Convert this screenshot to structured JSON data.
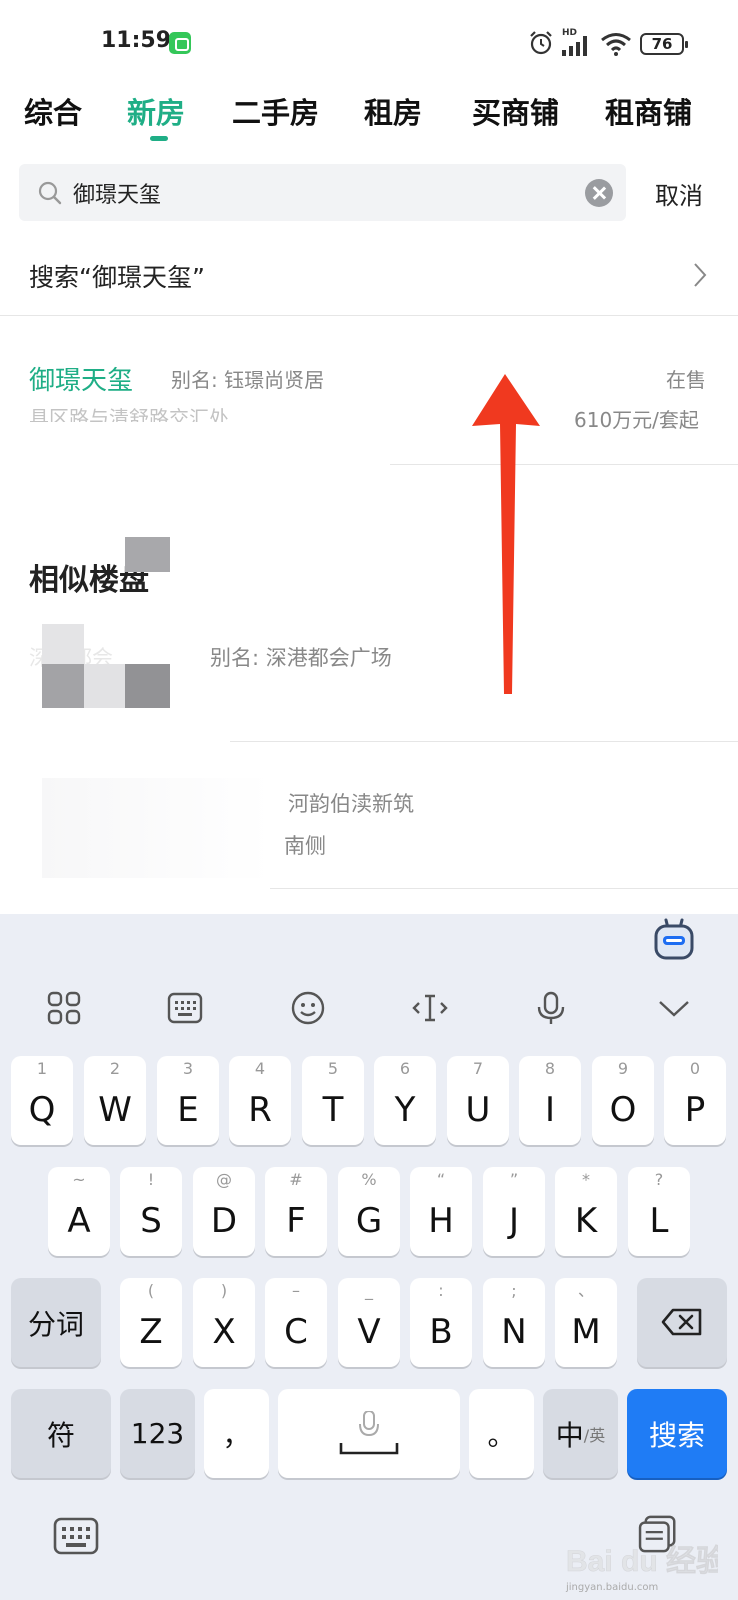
{
  "status_bar": {
    "time": "11:59",
    "hd_label": "HD",
    "battery": "76"
  },
  "tabs": [
    {
      "label": "综合",
      "active": false
    },
    {
      "label": "新房",
      "active": true
    },
    {
      "label": "二手房",
      "active": false
    },
    {
      "label": "租房",
      "active": false
    },
    {
      "label": "买商铺",
      "active": false
    },
    {
      "label": "租商铺",
      "active": false
    }
  ],
  "search": {
    "value": "御璟天玺",
    "cancel_label": "取消",
    "suggestion": "搜索“御璟天玺”"
  },
  "result": {
    "name": "御璟天玺",
    "alias": "别名: 钰璟尚贤居",
    "status": "在售",
    "address": "具区路与清舒路交汇处",
    "price": "610万元/套起"
  },
  "similar": {
    "title": "相似楼盘",
    "items": [
      {
        "name": "深港都会",
        "alias": "别名: 深港都会广场"
      },
      {
        "alias": "河韵伯渎新筑",
        "address": "南侧"
      }
    ]
  },
  "keyboard": {
    "row1": [
      {
        "hint": "1",
        "key": "Q"
      },
      {
        "hint": "2",
        "key": "W"
      },
      {
        "hint": "3",
        "key": "E"
      },
      {
        "hint": "4",
        "key": "R"
      },
      {
        "hint": "5",
        "key": "T"
      },
      {
        "hint": "6",
        "key": "Y"
      },
      {
        "hint": "7",
        "key": "U"
      },
      {
        "hint": "8",
        "key": "I"
      },
      {
        "hint": "9",
        "key": "O"
      },
      {
        "hint": "0",
        "key": "P"
      }
    ],
    "row2": [
      {
        "hint": "~",
        "key": "A"
      },
      {
        "hint": "!",
        "key": "S"
      },
      {
        "hint": "@",
        "key": "D"
      },
      {
        "hint": "#",
        "key": "F"
      },
      {
        "hint": "%",
        "key": "G"
      },
      {
        "hint": "“",
        "key": "H"
      },
      {
        "hint": "”",
        "key": "J"
      },
      {
        "hint": "*",
        "key": "K"
      },
      {
        "hint": "?",
        "key": "L"
      }
    ],
    "row3": [
      {
        "hint": "(",
        "key": "Z"
      },
      {
        "hint": ")",
        "key": "X"
      },
      {
        "hint": "–",
        "key": "C"
      },
      {
        "hint": "_",
        "key": "V"
      },
      {
        "hint": ":",
        "key": "B"
      },
      {
        "hint": ";",
        "key": "N"
      },
      {
        "hint": "、",
        "key": "M"
      }
    ],
    "segment_label": "分词",
    "symbol_label": "符",
    "numbers_label": "123",
    "comma_label": "，",
    "period_label": "。",
    "lang_main": "中",
    "lang_sub": "/英",
    "search_label": "搜索"
  },
  "watermark": {
    "text": "Bai du 经验",
    "url": "jingyan.baidu.com"
  }
}
